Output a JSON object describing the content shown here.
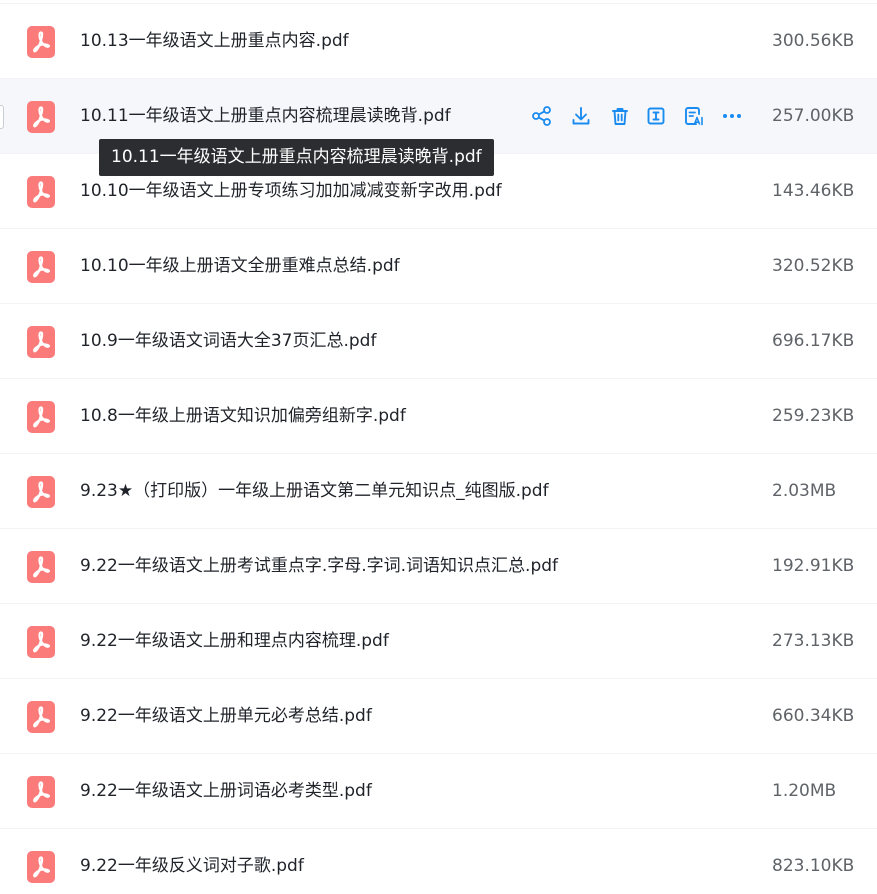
{
  "colors": {
    "pdf_icon": "#fb7a7a",
    "action_blue": "#1a8cf0",
    "hover_row_bg": "#f5f7fb",
    "tooltip_bg": "#2b2d31"
  },
  "files": [
    {
      "name": "10.13一年级语文上册重点内容.pdf",
      "size": "300.56KB"
    },
    {
      "name": "10.11一年级语文上册重点内容梳理晨读晚背.pdf",
      "size": "257.00KB"
    },
    {
      "name": "10.10一年级语文上册专项练习加加减减变新字改用.pdf",
      "size": "143.46KB"
    },
    {
      "name": "10.10一年级上册语文全册重难点总结.pdf",
      "size": "320.52KB"
    },
    {
      "name": "10.9一年级语文词语大全37页汇总.pdf",
      "size": "696.17KB"
    },
    {
      "name": "10.8一年级上册语文知识加偏旁组新字.pdf",
      "size": "259.23KB"
    },
    {
      "name": "9.23★（打印版）一年级上册语文第二单元知识点_纯图版.pdf",
      "size": "2.03MB"
    },
    {
      "name": "9.22一年级语文上册考试重点字.字母.字词.词语知识点汇总.pdf",
      "size": "192.91KB"
    },
    {
      "name": "9.22一年级语文上册和理点内容梳理.pdf",
      "size": "273.13KB"
    },
    {
      "name": "9.22一年级语文上册单元必考总结.pdf",
      "size": "660.34KB"
    },
    {
      "name": "9.22一年级语文上册词语必考类型.pdf",
      "size": "1.20MB"
    },
    {
      "name": "9.22一年级反义词对子歌.pdf",
      "size": "823.10KB"
    }
  ],
  "hovered_actions": [
    {
      "name": "share-icon"
    },
    {
      "name": "download-icon"
    },
    {
      "name": "delete-icon"
    },
    {
      "name": "rename-icon"
    },
    {
      "name": "ai-summary-icon"
    },
    {
      "name": "more-icon"
    }
  ],
  "tooltip": {
    "text": "10.11一年级语文上册重点内容梳理晨读晚背.pdf"
  }
}
